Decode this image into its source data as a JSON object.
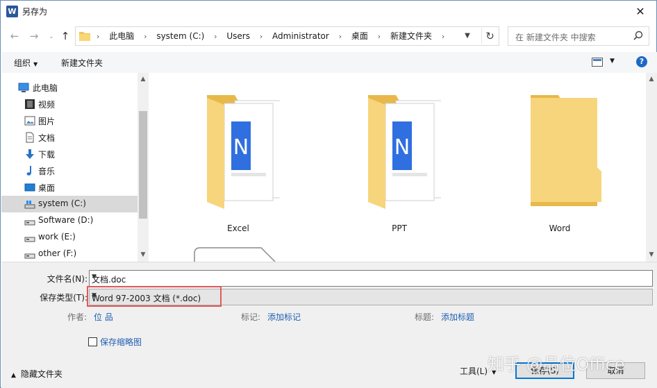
{
  "window": {
    "title": "另存为",
    "app_icon_letter": "W",
    "close_glyph": "✕"
  },
  "address": {
    "crumbs": [
      "此电脑",
      "system (C:)",
      "Users",
      "Administrator",
      "桌面",
      "新建文件夹"
    ],
    "separator": "›",
    "search_placeholder": "在 新建文件夹 中搜索"
  },
  "toolbar": {
    "organize": "组织",
    "new_folder": "新建文件夹",
    "help": "?"
  },
  "sidebar": {
    "items": [
      {
        "label": "此电脑",
        "icon": "computer-icon"
      },
      {
        "label": "视频",
        "icon": "video-icon"
      },
      {
        "label": "图片",
        "icon": "pictures-icon"
      },
      {
        "label": "文档",
        "icon": "documents-icon"
      },
      {
        "label": "下载",
        "icon": "download-icon"
      },
      {
        "label": "音乐",
        "icon": "music-icon"
      },
      {
        "label": "桌面",
        "icon": "desktop-icon"
      },
      {
        "label": "system (C:)",
        "icon": "drive-icon",
        "selected": true
      },
      {
        "label": "Software (D:)",
        "icon": "drive-icon"
      },
      {
        "label": "work (E:)",
        "icon": "drive-icon"
      },
      {
        "label": "other (F:)",
        "icon": "drive-icon"
      }
    ]
  },
  "folders": [
    {
      "name": "Excel",
      "icon": "folder-with-documents-icon"
    },
    {
      "name": "PPT",
      "icon": "folder-with-documents-icon"
    },
    {
      "name": "Word",
      "icon": "empty-folder-icon"
    }
  ],
  "form": {
    "filename_label": "文件名(N):",
    "filename_value": "文档.doc",
    "filetype_label": "保存类型(T):",
    "filetype_value": "Word 97-2003 文档 (*.doc)",
    "author_label": "作者:",
    "author_value": "位 品",
    "tags_label": "标记:",
    "tags_value": "添加标记",
    "title_label": "标题:",
    "title_value": "添加标题",
    "thumbnail_label": "保存缩略图",
    "thumbnail_checked": false
  },
  "footer": {
    "hide_folders": "隐藏文件夹",
    "tools": "工具(L)",
    "save": "保存(S)",
    "cancel": "取消",
    "watermark": "知乎 @品位Office"
  },
  "colors": {
    "accent": "#0078d7",
    "link": "#1f5fb3",
    "folder": "#f5d06f",
    "highlight_box": "#e05a5a",
    "word_blue": "#2b579a"
  }
}
